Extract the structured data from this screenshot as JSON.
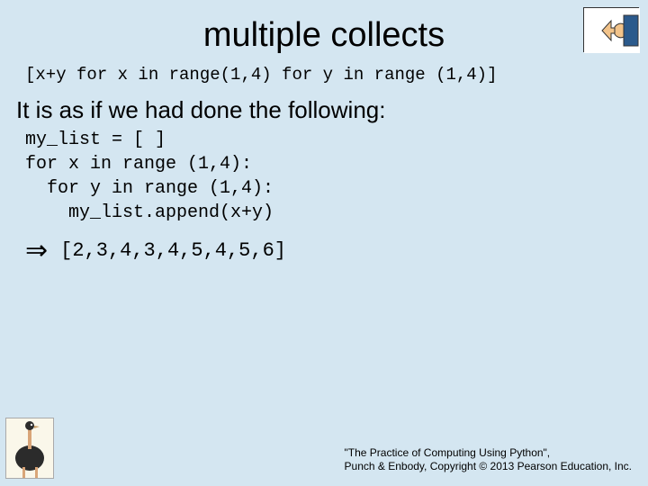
{
  "title": "multiple collects",
  "code_top": "[x+y for x in range(1,4) for y in range (1,4)]",
  "body_text": "It is as if we had done the following:",
  "code_block": {
    "l1": "my_list = [ ]",
    "l2": "for x in range (1,4):",
    "l3": "  for y in range (1,4):",
    "l4": "    my_list.append(x+y)"
  },
  "arrow": "⇒",
  "result": "[2,3,4,3,4,5,4,5,6]",
  "footer": {
    "line1": "\"The Practice of Computing Using Python\",",
    "line2": "Punch & Enbody, Copyright © 2013 Pearson Education, Inc."
  },
  "icons": {
    "hand": "pointing-hand-icon",
    "ostrich": "ostrich-icon"
  }
}
